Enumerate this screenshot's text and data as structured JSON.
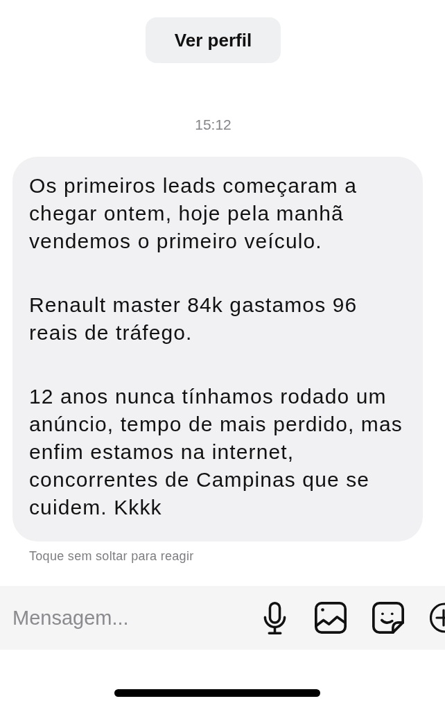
{
  "header": {
    "profile_button": "Ver perfil"
  },
  "timestamp": "15:12",
  "messages": [
    {
      "kind": "received",
      "paragraphs": [
        "Os primeiros leads começaram a chegar ontem, hoje pela manhã vendemos o primeiro veículo.",
        "Renault master 84k gastamos 96 reais de tráfego.",
        "12 anos nunca tínhamos rodado um anúncio, tempo de mais perdido, mas enfim estamos na internet, concorrentes de Campinas que se cuidem. Kkkk"
      ]
    }
  ],
  "reaction_hint": "Toque sem soltar para reagir",
  "composer": {
    "placeholder": "Mensagem...",
    "actions": [
      {
        "kind": "microphone"
      },
      {
        "kind": "image"
      },
      {
        "kind": "sticker"
      },
      {
        "kind": "plus"
      }
    ]
  }
}
